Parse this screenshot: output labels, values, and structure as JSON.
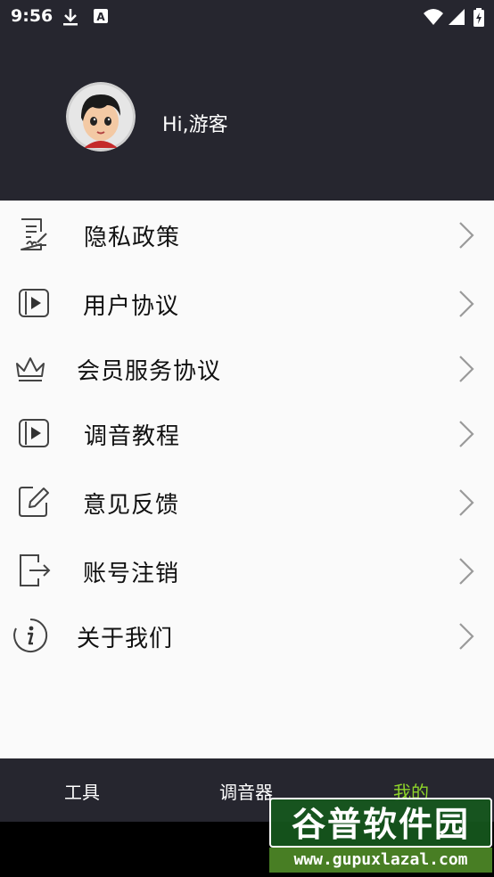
{
  "status_bar": {
    "time": "9:56",
    "icons_left": [
      "download-icon",
      "a-box-icon"
    ],
    "icons_right": [
      "wifi-icon",
      "signal-icon",
      "battery-icon"
    ]
  },
  "profile": {
    "greeting": "Hi,游客",
    "avatar": "cartoon-boy-avatar"
  },
  "menu": {
    "items": [
      {
        "label": "隐私政策",
        "icon": "document-pen-icon"
      },
      {
        "label": "用户协议",
        "icon": "play-book-icon"
      },
      {
        "label": "会员服务协议",
        "icon": "crown-icon"
      },
      {
        "label": "调音教程",
        "icon": "play-book-icon"
      },
      {
        "label": "意见反馈",
        "icon": "edit-icon"
      },
      {
        "label": "账号注销",
        "icon": "logout-icon"
      },
      {
        "label": "关于我们",
        "icon": "info-icon"
      }
    ]
  },
  "tabbar": {
    "tabs": [
      {
        "label": "工具"
      },
      {
        "label": "调音器"
      },
      {
        "label": "我的",
        "active": true
      }
    ],
    "active_color": "#8ed42a"
  },
  "watermark": {
    "title": "谷普软件园",
    "url": "www.gupuxlazal.com"
  },
  "colors": {
    "header_bg": "#26262f",
    "menu_bg": "#fafafa",
    "icon_stroke": "#444444",
    "chevron": "#9a9a9a"
  }
}
